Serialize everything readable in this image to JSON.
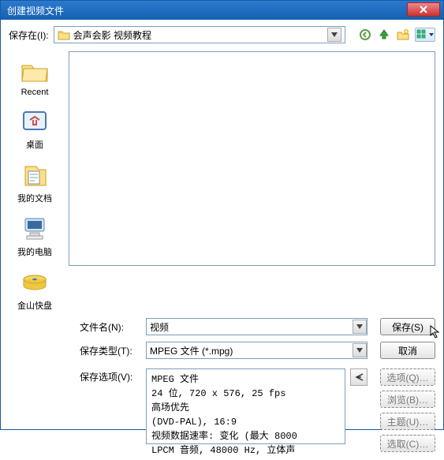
{
  "title": "创建视频文件",
  "save_in_label": "保存在(I):",
  "current_dir": "会声会影  视频教程",
  "places": [
    {
      "label": "Recent"
    },
    {
      "label": "桌面"
    },
    {
      "label": "我的文档"
    },
    {
      "label": "我的电脑"
    },
    {
      "label": "金山快盘"
    }
  ],
  "filename_label": "文件名(N):",
  "filename_value": "视频",
  "filetype_label": "保存类型(T):",
  "filetype_value": "MPEG 文件 (*.mpg)",
  "save_btn": "保存(S)",
  "cancel_btn": "取消",
  "save_options_label": "保存选项(V):",
  "options_btn": "选项(Q)…",
  "browse_btn": "浏览(B)…",
  "subject_btn": "主题(U)…",
  "select_btn": "选取(C)…",
  "info_lines": {
    "l1": "MPEG 文件",
    "l2": "24 位, 720 x 576, 25 fps",
    "l3": "高场优先",
    "l4": "(DVD-PAL), 16:9",
    "l5": "视频数据速率: 变化 (最大  8000",
    "l6": "LPCM 音频, 48000 Hz, 立体声"
  }
}
